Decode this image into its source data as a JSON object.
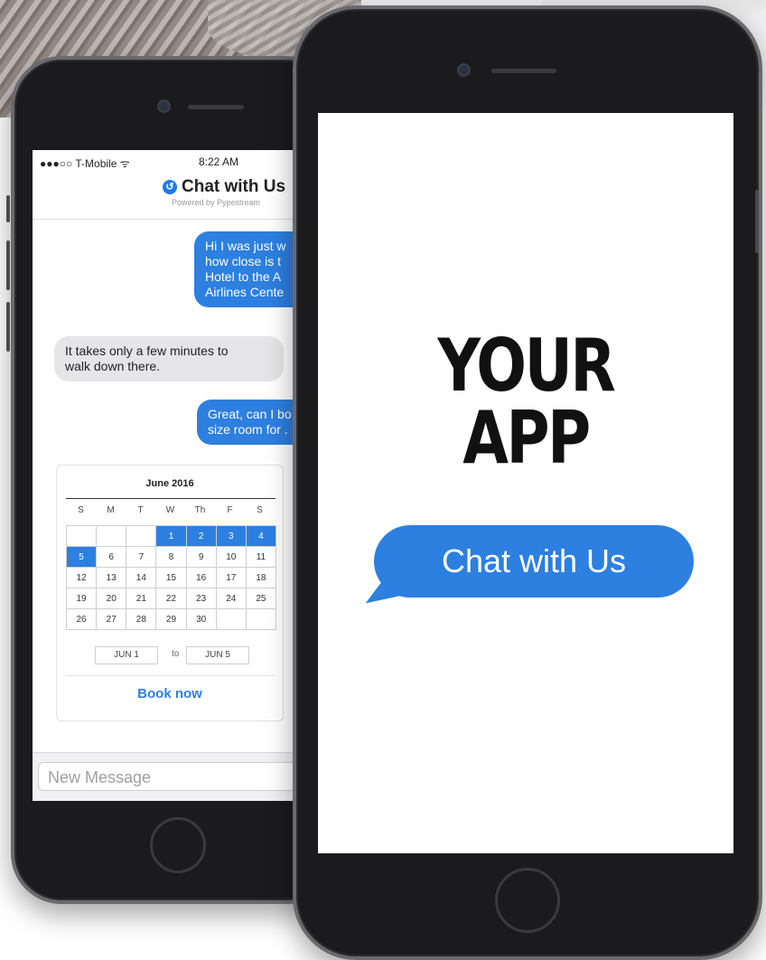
{
  "colors": {
    "accent": "#2d7fe0",
    "phone_body": "#1b1b1d",
    "bubble_incoming": "#e6e6e8"
  },
  "back_phone": {
    "status": {
      "carrier": "●●●○○ T-Mobile ᯤ",
      "time": "8:22 AM"
    },
    "header": {
      "logo_icon": "chat-logo-icon",
      "title": "Chat with Us",
      "subtitle": "Powered by Pypestream"
    },
    "messages": [
      {
        "from": "user",
        "text_lines": [
          "Hi I was just w",
          "how close is t",
          "Hotel to the A",
          "Airlines Cente"
        ]
      },
      {
        "from": "bot",
        "text_lines": [
          "It takes only a few minutes to",
          "walk down there."
        ]
      },
      {
        "from": "user",
        "text_lines": [
          "Great, can I bo",
          "size room for ."
        ]
      }
    ],
    "calendar": {
      "title": "June 2016",
      "days_of_week": [
        "S",
        "M",
        "T",
        "W",
        "Th",
        "F",
        "S"
      ],
      "weeks": [
        [
          "",
          "",
          "",
          "1",
          "2",
          "3",
          "4"
        ],
        [
          "5",
          "6",
          "7",
          "8",
          "9",
          "10",
          "11"
        ],
        [
          "12",
          "13",
          "14",
          "15",
          "16",
          "17",
          "18"
        ],
        [
          "19",
          "20",
          "21",
          "22",
          "23",
          "24",
          "25"
        ],
        [
          "26",
          "27",
          "28",
          "29",
          "30",
          "",
          ""
        ]
      ],
      "selected_days": [
        "1",
        "2",
        "3",
        "4",
        "5"
      ],
      "start_date": "JUN 1",
      "to_label": "to",
      "end_date": "JUN 5",
      "book_button": "Book now"
    },
    "compose": {
      "placeholder": "New Message"
    }
  },
  "front_phone": {
    "headline_line1": "YOUR",
    "headline_line2": "APP",
    "chat_button": "Chat with Us"
  }
}
